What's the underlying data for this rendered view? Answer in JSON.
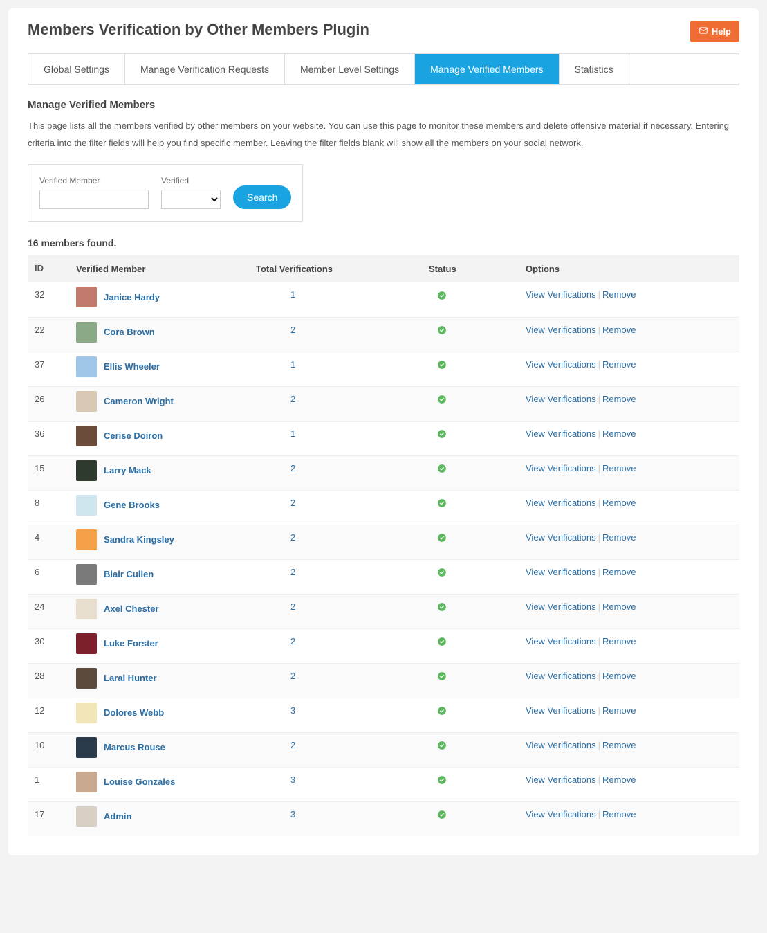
{
  "header": {
    "title": "Members Verification by Other Members Plugin",
    "help_label": "Help"
  },
  "tabs": [
    {
      "label": "Global Settings",
      "active": false
    },
    {
      "label": "Manage Verification Requests",
      "active": false
    },
    {
      "label": "Member Level Settings",
      "active": false
    },
    {
      "label": "Manage Verified Members",
      "active": true
    },
    {
      "label": "Statistics",
      "active": false
    }
  ],
  "section": {
    "title": "Manage Verified Members",
    "desc": "This page lists all the members verified by other members on your website. You can use this page to monitor these members and delete offensive material if necessary. Entering criteria into the filter fields will help you find specific member. Leaving the filter fields blank will show all the members on your social network."
  },
  "filters": {
    "member_label": "Verified Member",
    "member_value": "",
    "verified_label": "Verified",
    "verified_value": "",
    "search_label": "Search"
  },
  "count_text": "16 members found.",
  "table": {
    "headers": {
      "id": "ID",
      "member": "Verified Member",
      "total": "Total Verifications",
      "status": "Status",
      "options": "Options"
    },
    "option_labels": {
      "view": "View Verifications",
      "remove": "Remove"
    },
    "rows": [
      {
        "id": "32",
        "name": "Janice Hardy",
        "total": "1",
        "avatar": "#c27a6e"
      },
      {
        "id": "22",
        "name": "Cora Brown",
        "total": "2",
        "avatar": "#8aa987"
      },
      {
        "id": "37",
        "name": "Ellis Wheeler",
        "total": "1",
        "avatar": "#9fc5e8"
      },
      {
        "id": "26",
        "name": "Cameron Wright",
        "total": "2",
        "avatar": "#d9c8b4"
      },
      {
        "id": "36",
        "name": "Cerise Doiron",
        "total": "1",
        "avatar": "#6b4c3a"
      },
      {
        "id": "15",
        "name": "Larry Mack",
        "total": "2",
        "avatar": "#2f3a2e"
      },
      {
        "id": "8",
        "name": "Gene Brooks",
        "total": "2",
        "avatar": "#cfe6ef"
      },
      {
        "id": "4",
        "name": "Sandra Kingsley",
        "total": "2",
        "avatar": "#f4a14a"
      },
      {
        "id": "6",
        "name": "Blair Cullen",
        "total": "2",
        "avatar": "#7a7a7a"
      },
      {
        "id": "24",
        "name": "Axel Chester",
        "total": "2",
        "avatar": "#e8dfcf"
      },
      {
        "id": "30",
        "name": "Luke Forster",
        "total": "2",
        "avatar": "#7a1f2b"
      },
      {
        "id": "28",
        "name": "Laral Hunter",
        "total": "2",
        "avatar": "#5c4a3d"
      },
      {
        "id": "12",
        "name": "Dolores Webb",
        "total": "3",
        "avatar": "#f0e6b8"
      },
      {
        "id": "10",
        "name": "Marcus Rouse",
        "total": "2",
        "avatar": "#2b3a4a"
      },
      {
        "id": "1",
        "name": "Louise Gonzales",
        "total": "3",
        "avatar": "#c9a890"
      },
      {
        "id": "17",
        "name": "Admin",
        "total": "3",
        "avatar": "#d8d0c4"
      }
    ]
  }
}
